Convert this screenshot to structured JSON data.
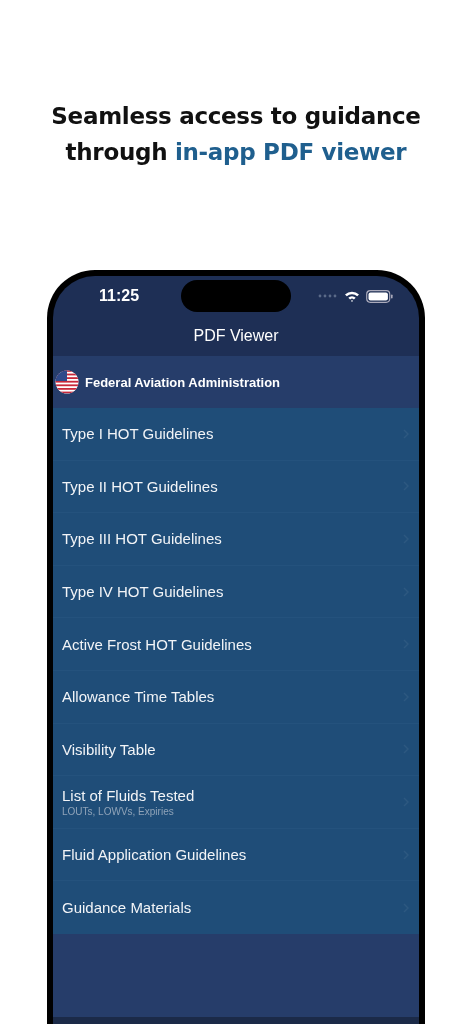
{
  "headline": {
    "line1": "Seamless access to guidance",
    "line2_prefix": "through ",
    "line2_highlight": "in-app PDF viewer"
  },
  "status_bar": {
    "time": "11:25"
  },
  "nav": {
    "title": "PDF Viewer"
  },
  "section": {
    "title": "Federal Aviation Administration"
  },
  "items": [
    {
      "label": "Type I HOT Guidelines"
    },
    {
      "label": "Type II HOT Guidelines"
    },
    {
      "label": "Type III HOT Guidelines"
    },
    {
      "label": "Type IV HOT Guidelines"
    },
    {
      "label": "Active Frost HOT Guidelines"
    },
    {
      "label": "Allowance Time Tables"
    },
    {
      "label": "Visibility Table"
    },
    {
      "label": "List of Fluids Tested",
      "subtitle": "LOUTs, LOWVs, Expiries"
    },
    {
      "label": "Fluid Application Guidelines"
    },
    {
      "label": "Guidance Materials"
    }
  ]
}
